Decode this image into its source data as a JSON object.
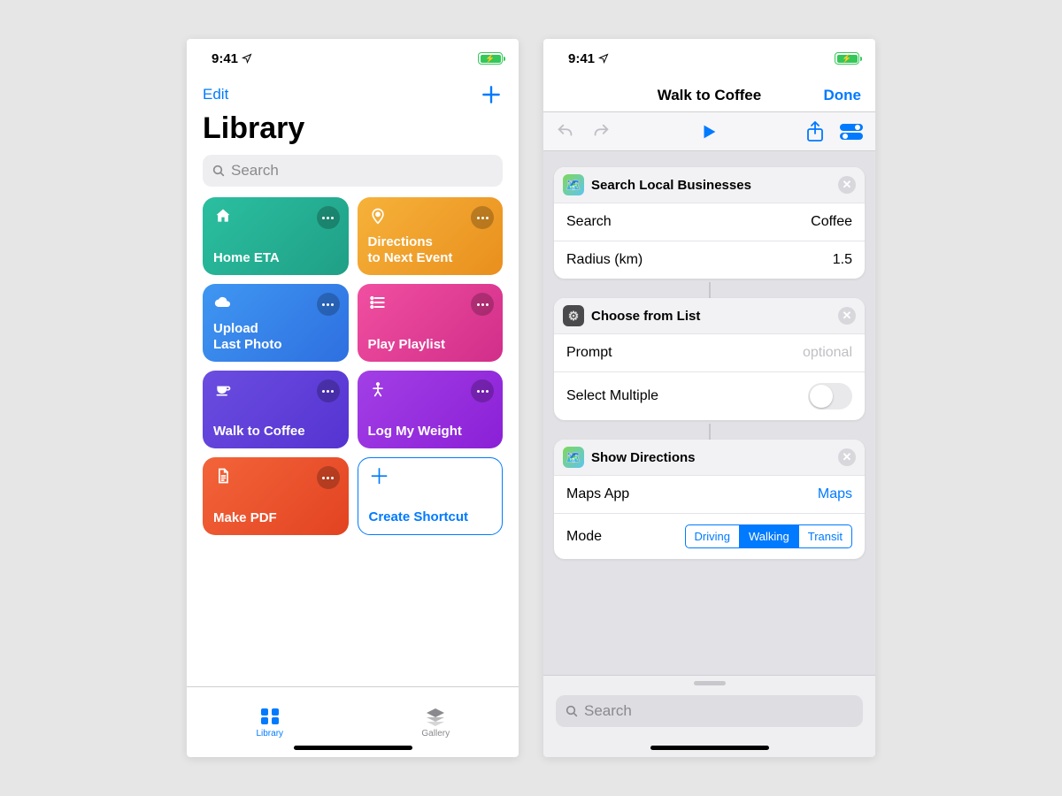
{
  "status": {
    "time": "9:41",
    "battery_state": "charging"
  },
  "left": {
    "edit": "Edit",
    "title": "Library",
    "search_placeholder": "Search",
    "tiles": [
      {
        "label": "Home ETA",
        "icon": "home",
        "gradient": [
          "#2bbfa0",
          "#1f9f86"
        ]
      },
      {
        "label": "Directions\nto Next Event",
        "icon": "pin",
        "gradient": [
          "#f6b23a",
          "#e98f1e"
        ]
      },
      {
        "label": "Upload\nLast Photo",
        "icon": "cloud",
        "gradient": [
          "#3f97f2",
          "#2e6fe0"
        ]
      },
      {
        "label": "Play Playlist",
        "icon": "list",
        "gradient": [
          "#f14fa0",
          "#d12e8a"
        ]
      },
      {
        "label": "Walk to Coffee",
        "icon": "cup",
        "gradient": [
          "#6b4de0",
          "#5533d1"
        ]
      },
      {
        "label": "Log My Weight",
        "icon": "person",
        "gradient": [
          "#a23fe6",
          "#8b20d6"
        ]
      },
      {
        "label": "Make PDF",
        "icon": "doc",
        "gradient": [
          "#f3643a",
          "#e24321"
        ]
      }
    ],
    "create_label": "Create Shortcut",
    "tabs": {
      "library": "Library",
      "gallery": "Gallery"
    }
  },
  "right": {
    "title": "Walk to Coffee",
    "done": "Done",
    "actions": [
      {
        "app_icon": "maps",
        "title": "Search Local Businesses",
        "rows": [
          {
            "label": "Search",
            "value": "Coffee",
            "type": "text"
          },
          {
            "label": "Radius (km)",
            "value": "1.5",
            "type": "text"
          }
        ]
      },
      {
        "app_icon": "gear",
        "title": "Choose from List",
        "rows": [
          {
            "label": "Prompt",
            "value": "optional",
            "type": "placeholder"
          },
          {
            "label": "Select Multiple",
            "value": "off",
            "type": "toggle"
          }
        ]
      },
      {
        "app_icon": "maps",
        "title": "Show Directions",
        "rows": [
          {
            "label": "Maps App",
            "value": "Maps",
            "type": "link"
          },
          {
            "label": "Mode",
            "type": "segmented",
            "options": [
              "Driving",
              "Walking",
              "Transit"
            ],
            "selected": "Walking"
          }
        ]
      }
    ],
    "sheet_search_placeholder": "Search"
  }
}
